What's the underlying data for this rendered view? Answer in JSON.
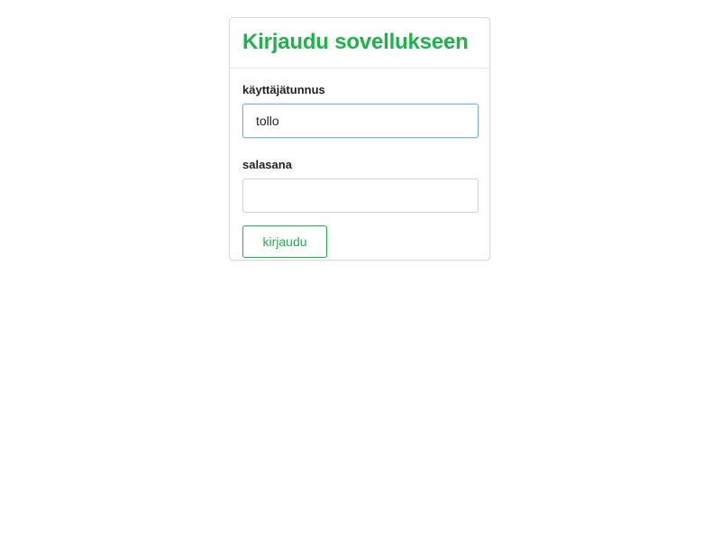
{
  "login": {
    "title": "Kirjaudu sovellukseen",
    "username": {
      "label": "käyttäjätunnus",
      "value": "tollo",
      "focused": true
    },
    "password": {
      "label": "salasana",
      "value": ""
    },
    "submit_label": "kirjaudu"
  },
  "colors": {
    "accent": "#1db34a",
    "focus_border": "#7fb4d6",
    "border": "#d9d9d9"
  }
}
